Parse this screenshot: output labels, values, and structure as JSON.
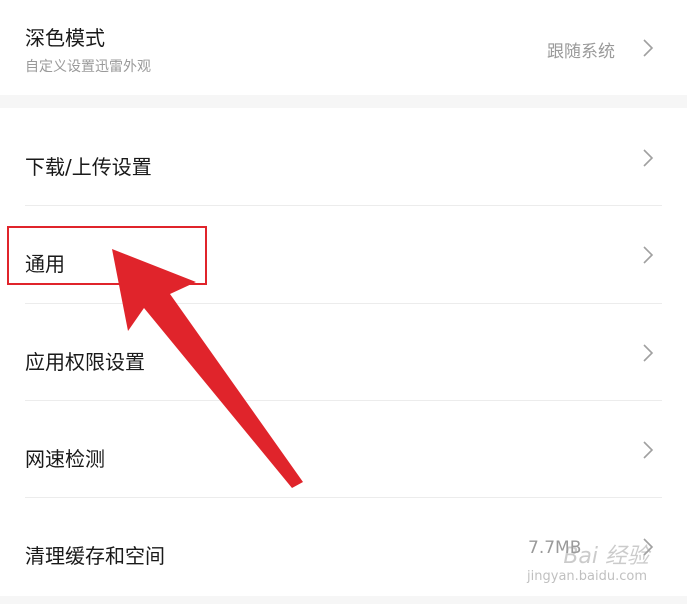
{
  "dark_mode": {
    "title": "深色模式",
    "subtitle": "自定义设置迅雷外观",
    "value": "跟随系统"
  },
  "menu": {
    "download_upload": "下载/上传设置",
    "general": "通用",
    "app_permissions": "应用权限设置",
    "speed_test": "网速检测",
    "clear_cache": "清理缓存和空间",
    "cache_value": "7.7MB"
  },
  "watermark": {
    "brand": "Bai 经验",
    "url": "jingyan.baidu.com"
  },
  "colors": {
    "annotation_red": "#e0242b",
    "text_primary": "#1a1a1a",
    "text_secondary": "#9a9a9a"
  },
  "icons": [
    "chevron-right-icon"
  ]
}
